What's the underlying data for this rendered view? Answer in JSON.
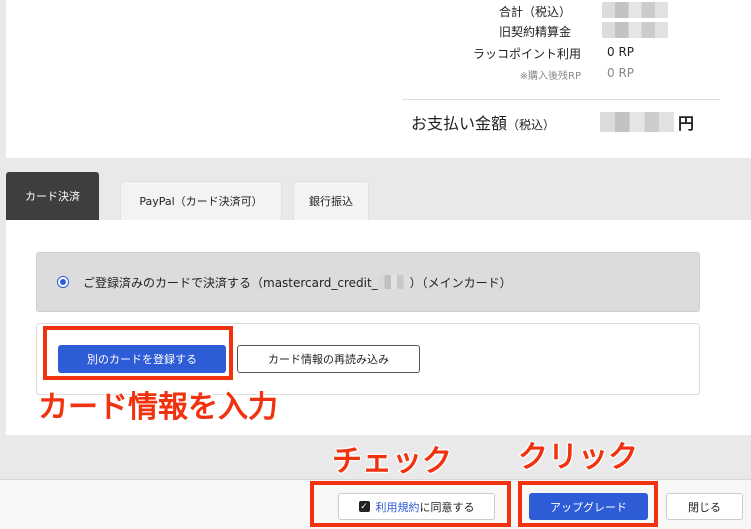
{
  "summary": {
    "total_label": "合計（税込）",
    "old_contract_label": "旧契約精算金",
    "points_label": "ラッコポイント利用",
    "points_value": "0 RP",
    "remaining_label": "※購入後残RP",
    "remaining_value": "0 RP",
    "pay_label": "お支払い金額",
    "pay_tax_note": "（税込）",
    "pay_currency": "円"
  },
  "tabs": [
    {
      "label": "カード決済"
    },
    {
      "label": "PayPal（カード決済可）"
    },
    {
      "label": "銀行振込"
    }
  ],
  "payment": {
    "registered_card_label": "ご登録済みのカードで決済する（mastercard_credit_",
    "registered_card_suffix": "）（メインカード）",
    "register_new_button": "別のカードを登録する",
    "reload_button": "カード情報の再読み込み"
  },
  "annotations": {
    "enter_card": "カード情報を入力",
    "check": "チェック",
    "click": "クリック"
  },
  "footer": {
    "terms_link": "利用規約",
    "terms_suffix": "に同意する",
    "upgrade_button": "アップグレード",
    "close_button": "閉じる"
  },
  "colors": {
    "accent_blue": "#2e5bd6",
    "annotation_red": "#f0320f"
  }
}
